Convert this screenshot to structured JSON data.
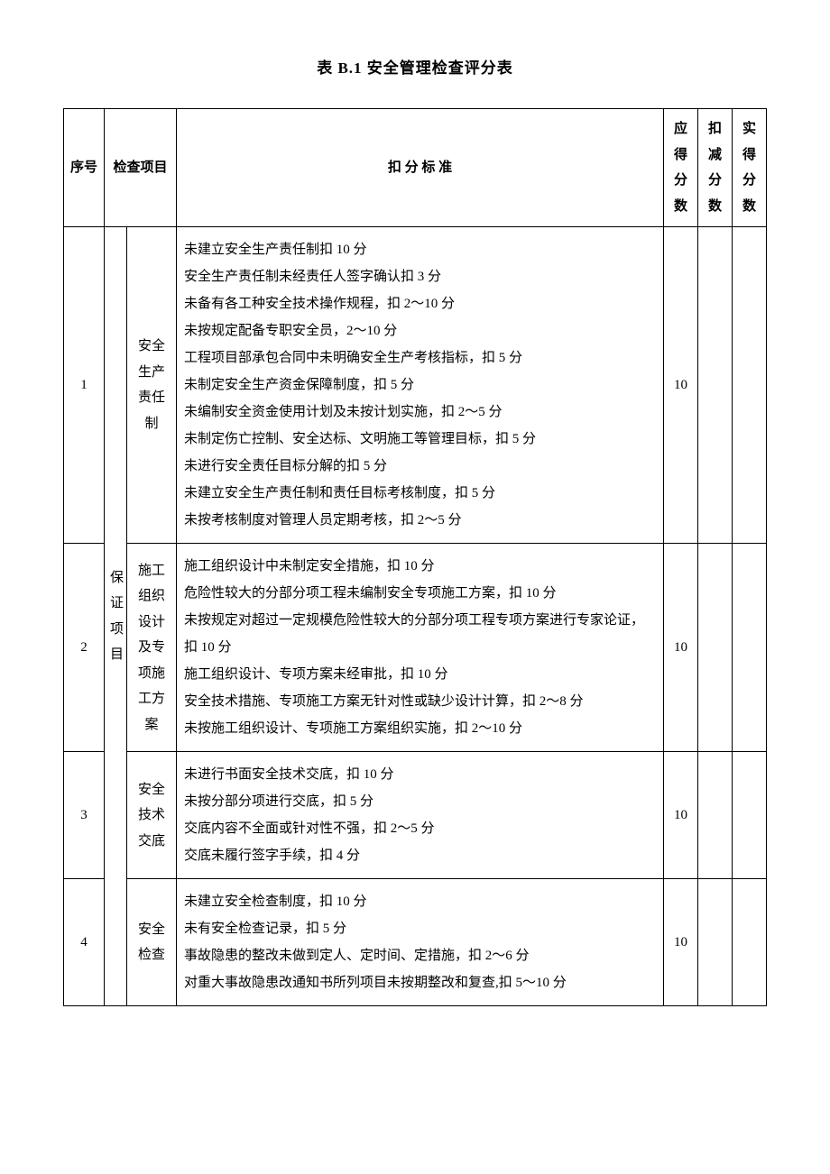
{
  "title": "表 B.1 安全管理检查评分表",
  "headers": {
    "seq": "序号",
    "check_item": "检查项目",
    "criteria": "扣 分 标 准",
    "score_full": "应得分数",
    "score_deduct": "扣减分数",
    "score_actual": "实得分数"
  },
  "group_label": "保证项目",
  "rows": [
    {
      "seq": "1",
      "item": "安全生产责任制",
      "criteria": "未建立安全生产责任制扣 10 分\n安全生产责任制未经责任人签字确认扣 3 分\n未备有各工种安全技术操作规程，扣 2～10 分\n未按规定配备专职安全员，2～10 分\n工程项目部承包合同中未明确安全生产考核指标，扣 5 分\n未制定安全生产资金保障制度，扣 5 分\n未编制安全资金使用计划及未按计划实施，扣 2～5 分\n未制定伤亡控制、安全达标、文明施工等管理目标，扣 5 分\n未进行安全责任目标分解的扣 5 分\n未建立安全生产责任制和责任目标考核制度，扣 5 分\n未按考核制度对管理人员定期考核，扣 2～5 分",
      "score_full": "10",
      "score_deduct": "",
      "score_actual": ""
    },
    {
      "seq": "2",
      "item": "施工组织设计及专项施工方案",
      "criteria": "施工组织设计中未制定安全措施，扣 10 分\n危险性较大的分部分项工程未编制安全专项施工方案，扣 10 分\n未按规定对超过一定规模危险性较大的分部分项工程专项方案进行专家论证，扣 10 分\n施工组织设计、专项方案未经审批，扣 10 分\n安全技术措施、专项施工方案无针对性或缺少设计计算，扣 2～8 分\n未按施工组织设计、专项施工方案组织实施，扣 2～10 分",
      "score_full": "10",
      "score_deduct": "",
      "score_actual": ""
    },
    {
      "seq": "3",
      "item": "安全技术交底",
      "criteria": "未进行书面安全技术交底，扣 10 分\n未按分部分项进行交底，扣 5 分\n交底内容不全面或针对性不强，扣 2～5 分\n交底未履行签字手续，扣 4 分",
      "score_full": "10",
      "score_deduct": "",
      "score_actual": ""
    },
    {
      "seq": "4",
      "item": "安全检查",
      "criteria": "未建立安全检查制度，扣 10 分\n未有安全检查记录，扣 5 分\n事故隐患的整改未做到定人、定时间、定措施，扣 2～6 分\n对重大事故隐患改通知书所列项目未按期整改和复查,扣 5～10 分",
      "score_full": "10",
      "score_deduct": "",
      "score_actual": ""
    }
  ]
}
